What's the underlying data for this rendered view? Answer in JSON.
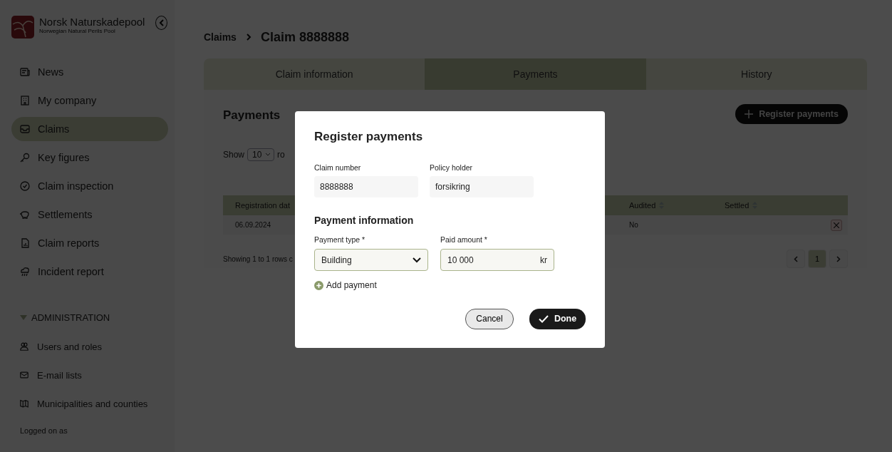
{
  "sidebar": {
    "logo": {
      "name": "Norsk Naturskadepool",
      "tagline": "Norwegian Natural Perils Pool"
    },
    "items": [
      {
        "label": "News",
        "kind": "news",
        "selected": false
      },
      {
        "label": "My company",
        "kind": "building",
        "selected": false
      },
      {
        "label": "Claims",
        "kind": "inbox",
        "selected": true
      },
      {
        "label": "Key figures",
        "kind": "key",
        "selected": false
      },
      {
        "label": "Claim inspection",
        "kind": "check",
        "selected": false
      },
      {
        "label": "Settlements",
        "kind": "piggy",
        "selected": false
      },
      {
        "label": "Claim reports",
        "kind": "report",
        "selected": false
      },
      {
        "label": "Incident report",
        "kind": "rain",
        "selected": false
      }
    ],
    "admin": {
      "label": "ADMINISTRATION",
      "expanded": true,
      "items": [
        {
          "label": "Users and roles",
          "kind": "users",
          "selected": false
        },
        {
          "label": "E-mail lists",
          "kind": "mail",
          "selected": false
        },
        {
          "label": "Municipalities and counties",
          "kind": "map",
          "selected": false
        }
      ]
    },
    "footer": "Logged on as"
  },
  "breadcrumb": [
    "Claims",
    "Claim 8888888"
  ],
  "tabs": [
    {
      "label": "Claim information",
      "selected": false
    },
    {
      "label": "Payments",
      "selected": true
    },
    {
      "label": "History",
      "selected": false
    }
  ],
  "payments": {
    "title": "Payments",
    "register_button": "Register payments",
    "show_label": "Show",
    "page_size": "10",
    "rows_label": "ro",
    "columns": [
      {
        "label": "Registration dat",
        "sortable": false
      },
      {
        "label": "Audited",
        "sortable": true
      },
      {
        "label": "Settled",
        "sortable": true
      }
    ],
    "rows": [
      {
        "registration_date": "06.09.2024",
        "audited": "No"
      }
    ],
    "summary": "Showing 1 to 1 rows c",
    "pages": [
      {
        "label": "1",
        "selected": true
      }
    ]
  },
  "dialog": {
    "title": "Register payments",
    "claim_number": {
      "label": "Claim number",
      "value": "8888888"
    },
    "policy_holder": {
      "label": "Policy holder",
      "value": "forsikring"
    },
    "section": "Payment information",
    "payment_type": {
      "label": "Payment type *",
      "value": "Building"
    },
    "paid_amount": {
      "label": "Paid amount *",
      "value": "10 000",
      "unit": "kr"
    },
    "add_link": "Add payment",
    "cancel": "Cancel",
    "done": "Done"
  }
}
